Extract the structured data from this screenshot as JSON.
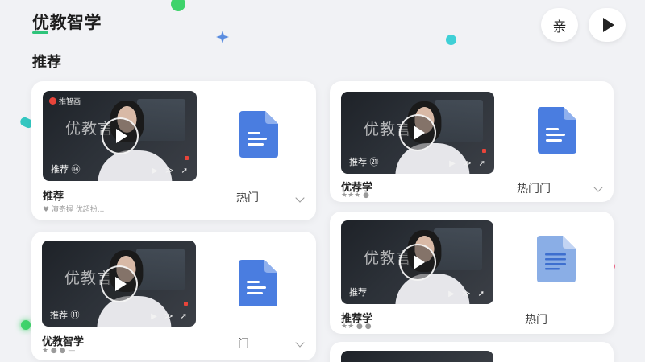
{
  "app": {
    "title": "优教智学",
    "top_label_button": "亲"
  },
  "section": {
    "title": "推荐"
  },
  "cards": [
    {
      "tag": "推荐 ⑭",
      "logo": "推智画",
      "watermark": "优教言",
      "title": "推荐",
      "meta": "♥ 演奇握  优超扮...",
      "category": "热门"
    },
    {
      "tag": "推荐 ㉑",
      "logo": "",
      "watermark": "优教言",
      "title": "优荐学",
      "meta": "★★★ ●",
      "category": "热门门"
    },
    {
      "tag": "推荐 ⑪",
      "logo": "",
      "watermark": "优教言",
      "title": "优教智学",
      "meta": "★ ● ● —",
      "category": "门"
    },
    {
      "tag": "推荐",
      "logo": "",
      "watermark": "优教言",
      "title": "推荐学",
      "meta": "★★ ● ●",
      "category": "热门"
    }
  ],
  "colors": {
    "accent": "#2ec47a",
    "doc_blue": "#4a7de0",
    "background": "#f1f2f5"
  }
}
